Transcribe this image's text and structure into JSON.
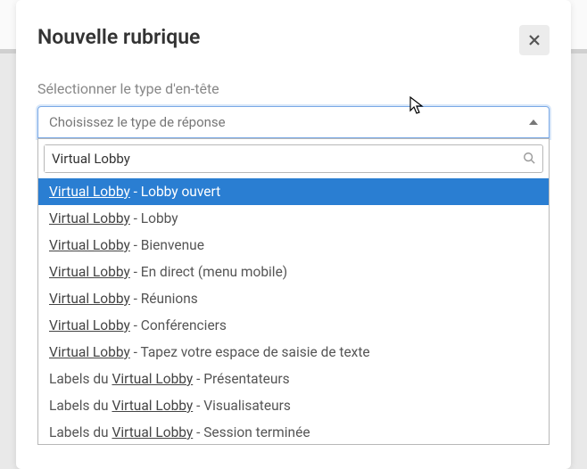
{
  "modal": {
    "title": "Nouvelle rubrique",
    "field_label": "Sélectionner le type d'en-tête",
    "select_placeholder": "Choisissez le type de réponse"
  },
  "search": {
    "value": "Virtual Lobby"
  },
  "options": [
    {
      "prefix": "",
      "match": "Virtual Lobby",
      "suffix": " - Lobby ouvert",
      "highlight": true
    },
    {
      "prefix": "",
      "match": "Virtual Lobby",
      "suffix": " - Lobby",
      "highlight": false
    },
    {
      "prefix": "",
      "match": "Virtual Lobby",
      "suffix": " - Bienvenue",
      "highlight": false
    },
    {
      "prefix": "",
      "match": "Virtual Lobby",
      "suffix": " - En direct (menu mobile)",
      "highlight": false
    },
    {
      "prefix": "",
      "match": "Virtual Lobby",
      "suffix": " - Réunions",
      "highlight": false
    },
    {
      "prefix": "",
      "match": "Virtual Lobby",
      "suffix": " - Conférenciers",
      "highlight": false
    },
    {
      "prefix": "",
      "match": "Virtual Lobby",
      "suffix": " - Tapez votre espace de saisie de texte",
      "highlight": false
    },
    {
      "prefix": "Labels du ",
      "match": "Virtual Lobby",
      "suffix": " - Présentateurs",
      "highlight": false
    },
    {
      "prefix": "Labels du ",
      "match": "Virtual Lobby",
      "suffix": " - Visualisateurs",
      "highlight": false
    },
    {
      "prefix": "Labels du ",
      "match": "Virtual Lobby",
      "suffix": " - Session terminée",
      "highlight": false
    }
  ]
}
